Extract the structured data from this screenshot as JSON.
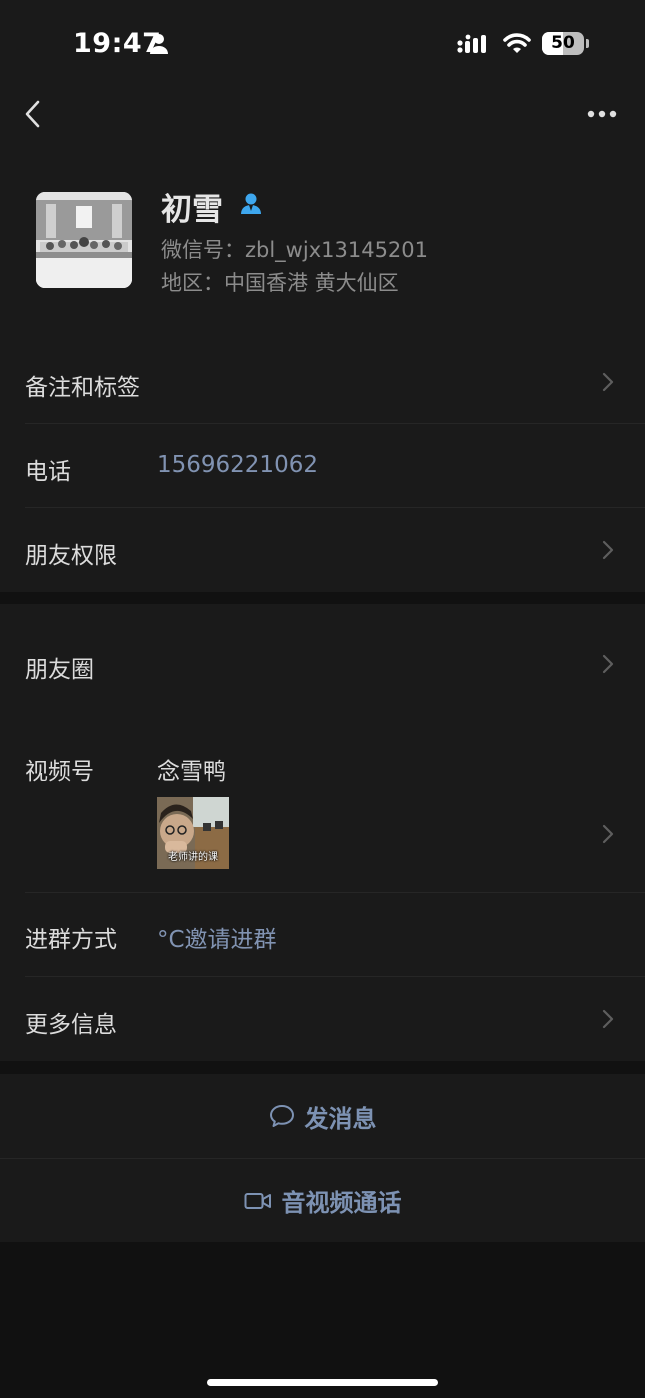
{
  "status_bar": {
    "time": "19:47",
    "battery": "50"
  },
  "profile": {
    "name": "初雪",
    "wechat_id": "微信号：zbl_wjx13145201",
    "region": "地区：中国香港 黄大仙区"
  },
  "rows": {
    "remark": "备注和标签",
    "phone_label": "电话",
    "phone_value": "15696221062",
    "permissions": "朋友权限",
    "moments": "朋友圈",
    "channels_label": "视频号",
    "channels_value": "念雪鸭",
    "channels_thumb_caption": "老师讲的课",
    "join_label": "进群方式",
    "join_value": "°C邀请进群",
    "more": "更多信息"
  },
  "actions": {
    "message": "发消息",
    "call": "音视频通话"
  },
  "colors": {
    "background": "#111111",
    "surface": "#1a1a1a",
    "accent": "#7d92b3",
    "value_blue": "#8193b2",
    "badge_blue": "#3ea7ee"
  }
}
